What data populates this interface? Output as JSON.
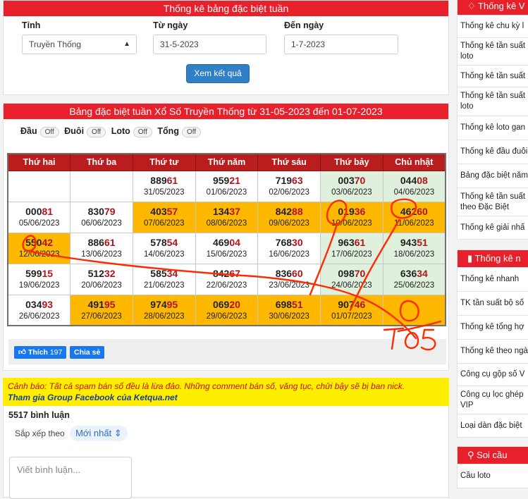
{
  "filter": {
    "title": "Thống kê bảng đặc biệt tuần",
    "province_label": "Tỉnh",
    "province_value": "Truyền Thống",
    "from_label": "Từ ngày",
    "from_value": "31-5-2023",
    "to_label": "Đến ngày",
    "to_value": "1-7-2023",
    "submit": "Xem kết quả"
  },
  "board": {
    "title": "Bảng đặc biệt tuần Xổ Số Truyền Thống từ 31-05-2023 đến 01-07-2023",
    "toggles": [
      {
        "label": "Đầu",
        "state": "Off"
      },
      {
        "label": "Đuôi",
        "state": "Off"
      },
      {
        "label": "Loto",
        "state": "Off"
      },
      {
        "label": "Tổng",
        "state": "Off"
      }
    ],
    "headers": [
      "Thứ hai",
      "Thứ ba",
      "Thứ tư",
      "Thứ năm",
      "Thứ sáu",
      "Thứ bảy",
      "Chủ nhật"
    ],
    "rows": [
      [
        {
          "num": "",
          "date": "",
          "hl": false
        },
        {
          "num": "",
          "date": "",
          "hl": false
        },
        {
          "num": "88961",
          "date": "31/05/2023",
          "hl": false
        },
        {
          "num": "95921",
          "date": "01/06/2023",
          "hl": false
        },
        {
          "num": "71963",
          "date": "02/06/2023",
          "hl": false
        },
        {
          "num": "00370",
          "date": "03/06/2023",
          "hl": false
        },
        {
          "num": "04408",
          "date": "04/06/2023",
          "hl": false
        }
      ],
      [
        {
          "num": "00081",
          "date": "05/06/2023",
          "hl": false
        },
        {
          "num": "83079",
          "date": "06/06/2023",
          "hl": false
        },
        {
          "num": "40357",
          "date": "07/06/2023",
          "hl": true
        },
        {
          "num": "13437",
          "date": "08/06/2023",
          "hl": true
        },
        {
          "num": "84288",
          "date": "09/06/2023",
          "hl": true
        },
        {
          "num": "01936",
          "date": "10/06/2023",
          "hl": true
        },
        {
          "num": "46260",
          "date": "11/06/2023",
          "hl": true
        }
      ],
      [
        {
          "num": "55042",
          "date": "12/06/2023",
          "hl": true
        },
        {
          "num": "88661",
          "date": "13/06/2023",
          "hl": false
        },
        {
          "num": "57854",
          "date": "14/06/2023",
          "hl": false
        },
        {
          "num": "46904",
          "date": "15/06/2023",
          "hl": false
        },
        {
          "num": "76830",
          "date": "16/06/2023",
          "hl": false
        },
        {
          "num": "96361",
          "date": "17/06/2023",
          "hl": false
        },
        {
          "num": "94351",
          "date": "18/06/2023",
          "hl": false
        }
      ],
      [
        {
          "num": "59915",
          "date": "19/06/2023",
          "hl": false
        },
        {
          "num": "51232",
          "date": "20/06/2023",
          "hl": false
        },
        {
          "num": "58534",
          "date": "21/06/2023",
          "hl": false
        },
        {
          "num": "84267",
          "date": "22/06/2023",
          "hl": false
        },
        {
          "num": "83660",
          "date": "23/06/2023",
          "hl": false
        },
        {
          "num": "09870",
          "date": "24/06/2023",
          "hl": false
        },
        {
          "num": "63634",
          "date": "25/06/2023",
          "hl": false
        }
      ],
      [
        {
          "num": "03493",
          "date": "26/06/2023",
          "hl": false
        },
        {
          "num": "49195",
          "date": "27/06/2023",
          "hl": true
        },
        {
          "num": "97495",
          "date": "28/06/2023",
          "hl": true
        },
        {
          "num": "06920",
          "date": "29/06/2023",
          "hl": true
        },
        {
          "num": "69851",
          "date": "30/06/2023",
          "hl": true
        },
        {
          "num": "90746",
          "date": "01/07/2023",
          "hl": true
        },
        {
          "num": "",
          "date": "",
          "hl": true
        }
      ]
    ],
    "like_label": "Thích",
    "like_count": "197",
    "share_label": "Chia sẻ"
  },
  "comments": {
    "warning": "Cảnh báo: Tất cả spam bán số đều là lừa đảo. Những comment bán số, văng tục, chửi bậy sẽ bị ban nick.",
    "group_link": "Tham gia Group Facebook của Ketqua.net",
    "count": "5517 bình luận",
    "sort_label": "Sắp xếp theo",
    "sort_value": "Mới nhất",
    "input_placeholder": "Viết bình luận..."
  },
  "sidebar": {
    "vip": {
      "title": "Thống kê V",
      "items": [
        "Thống kê chu kỳ l",
        "Thống kê tần suất loto",
        "Thống kê tần suất",
        "Thống kê tần suất loto",
        "Thống kê loto gan",
        "Thống kê đầu đuôi",
        "Bảng đặc biệt năm",
        "Thống kê tần suất theo Đặc Biệt",
        "Thống kê giải nhấ"
      ]
    },
    "stats": {
      "title": "Thống kê n",
      "items": [
        "Thống kê nhanh",
        "TK tần suất bộ số",
        "Thống kê tổng hợ",
        "Thống kê theo ngà",
        "Công cụ gộp số V",
        "Công cụ lọc ghép VIP",
        "Loại dàn đặc biệt"
      ]
    },
    "soicau": {
      "title": "Soi cầu",
      "items": [
        "Cầu loto"
      ]
    }
  },
  "annotation": {
    "text": "TO5",
    "color": "#ff2a00"
  }
}
